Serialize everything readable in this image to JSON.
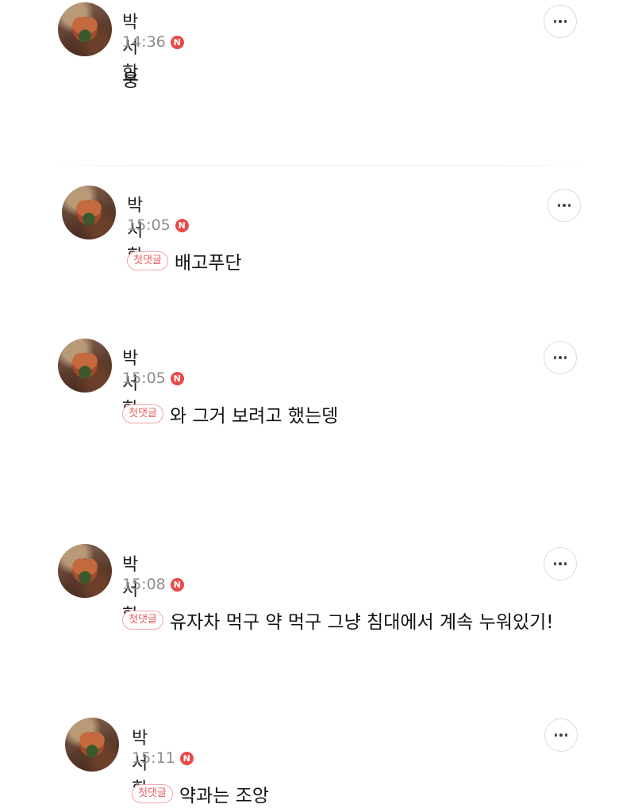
{
  "badge_first_comment": "첫댓글",
  "new_badge": "N",
  "comments": [
    {
      "author": "박서함",
      "time": "14:36",
      "text": "웅",
      "first": false
    },
    {
      "author": "박서함",
      "time": "15:05",
      "text": "배고푸단",
      "first": true
    },
    {
      "author": "박서함",
      "time": "15:05",
      "text": "와 그거 보려고 했는뎅",
      "first": true
    },
    {
      "author": "박서함",
      "time": "15:08",
      "text": "유자차 먹구 약 먹구 그냥 침대에서 계속 누워있기!",
      "first": true
    },
    {
      "author": "박서함",
      "time": "15:11",
      "text": "약과는 조앙",
      "first": true
    }
  ]
}
